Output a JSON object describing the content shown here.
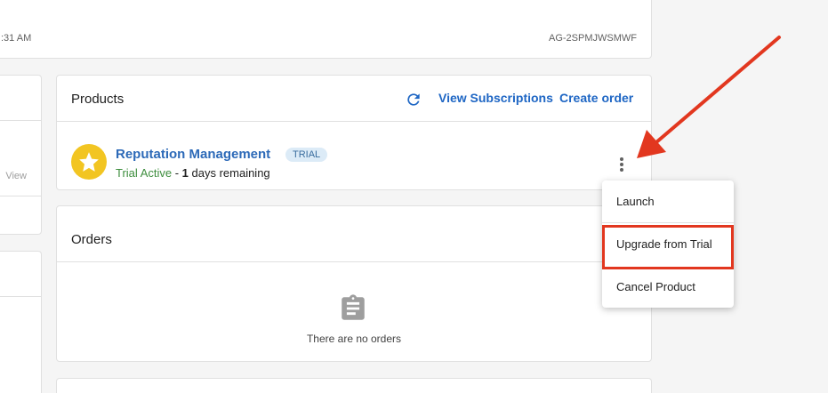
{
  "header": {
    "time_fragment": ":31 AM",
    "account_id": "AG-2SPMJWSMWF"
  },
  "left_panel": {
    "view_label": "View"
  },
  "products": {
    "title": "Products",
    "refresh_icon": "refresh-icon",
    "view_subscriptions_label": "View Subscriptions",
    "create_order_label": "Create order",
    "items": [
      {
        "name": "Reputation Management",
        "badge": "TRIAL",
        "icon": "star-icon",
        "status_active": "Trial Active",
        "status_separator": " - ",
        "days_count": "1",
        "days_suffix": " days remaining"
      }
    ]
  },
  "orders": {
    "title": "Orders",
    "empty_icon": "clipboard-icon",
    "empty_text": "There are no orders"
  },
  "menu": {
    "items": [
      {
        "label": "Launch"
      },
      {
        "label": "Upgrade from Trial"
      },
      {
        "label": "Cancel Product"
      }
    ]
  },
  "colors": {
    "link": "#1e66c4",
    "star_bg": "#f2c522",
    "active_green": "#3e8e3e",
    "annotation_red": "#e2371f",
    "badge_bg": "#dcebf7"
  }
}
